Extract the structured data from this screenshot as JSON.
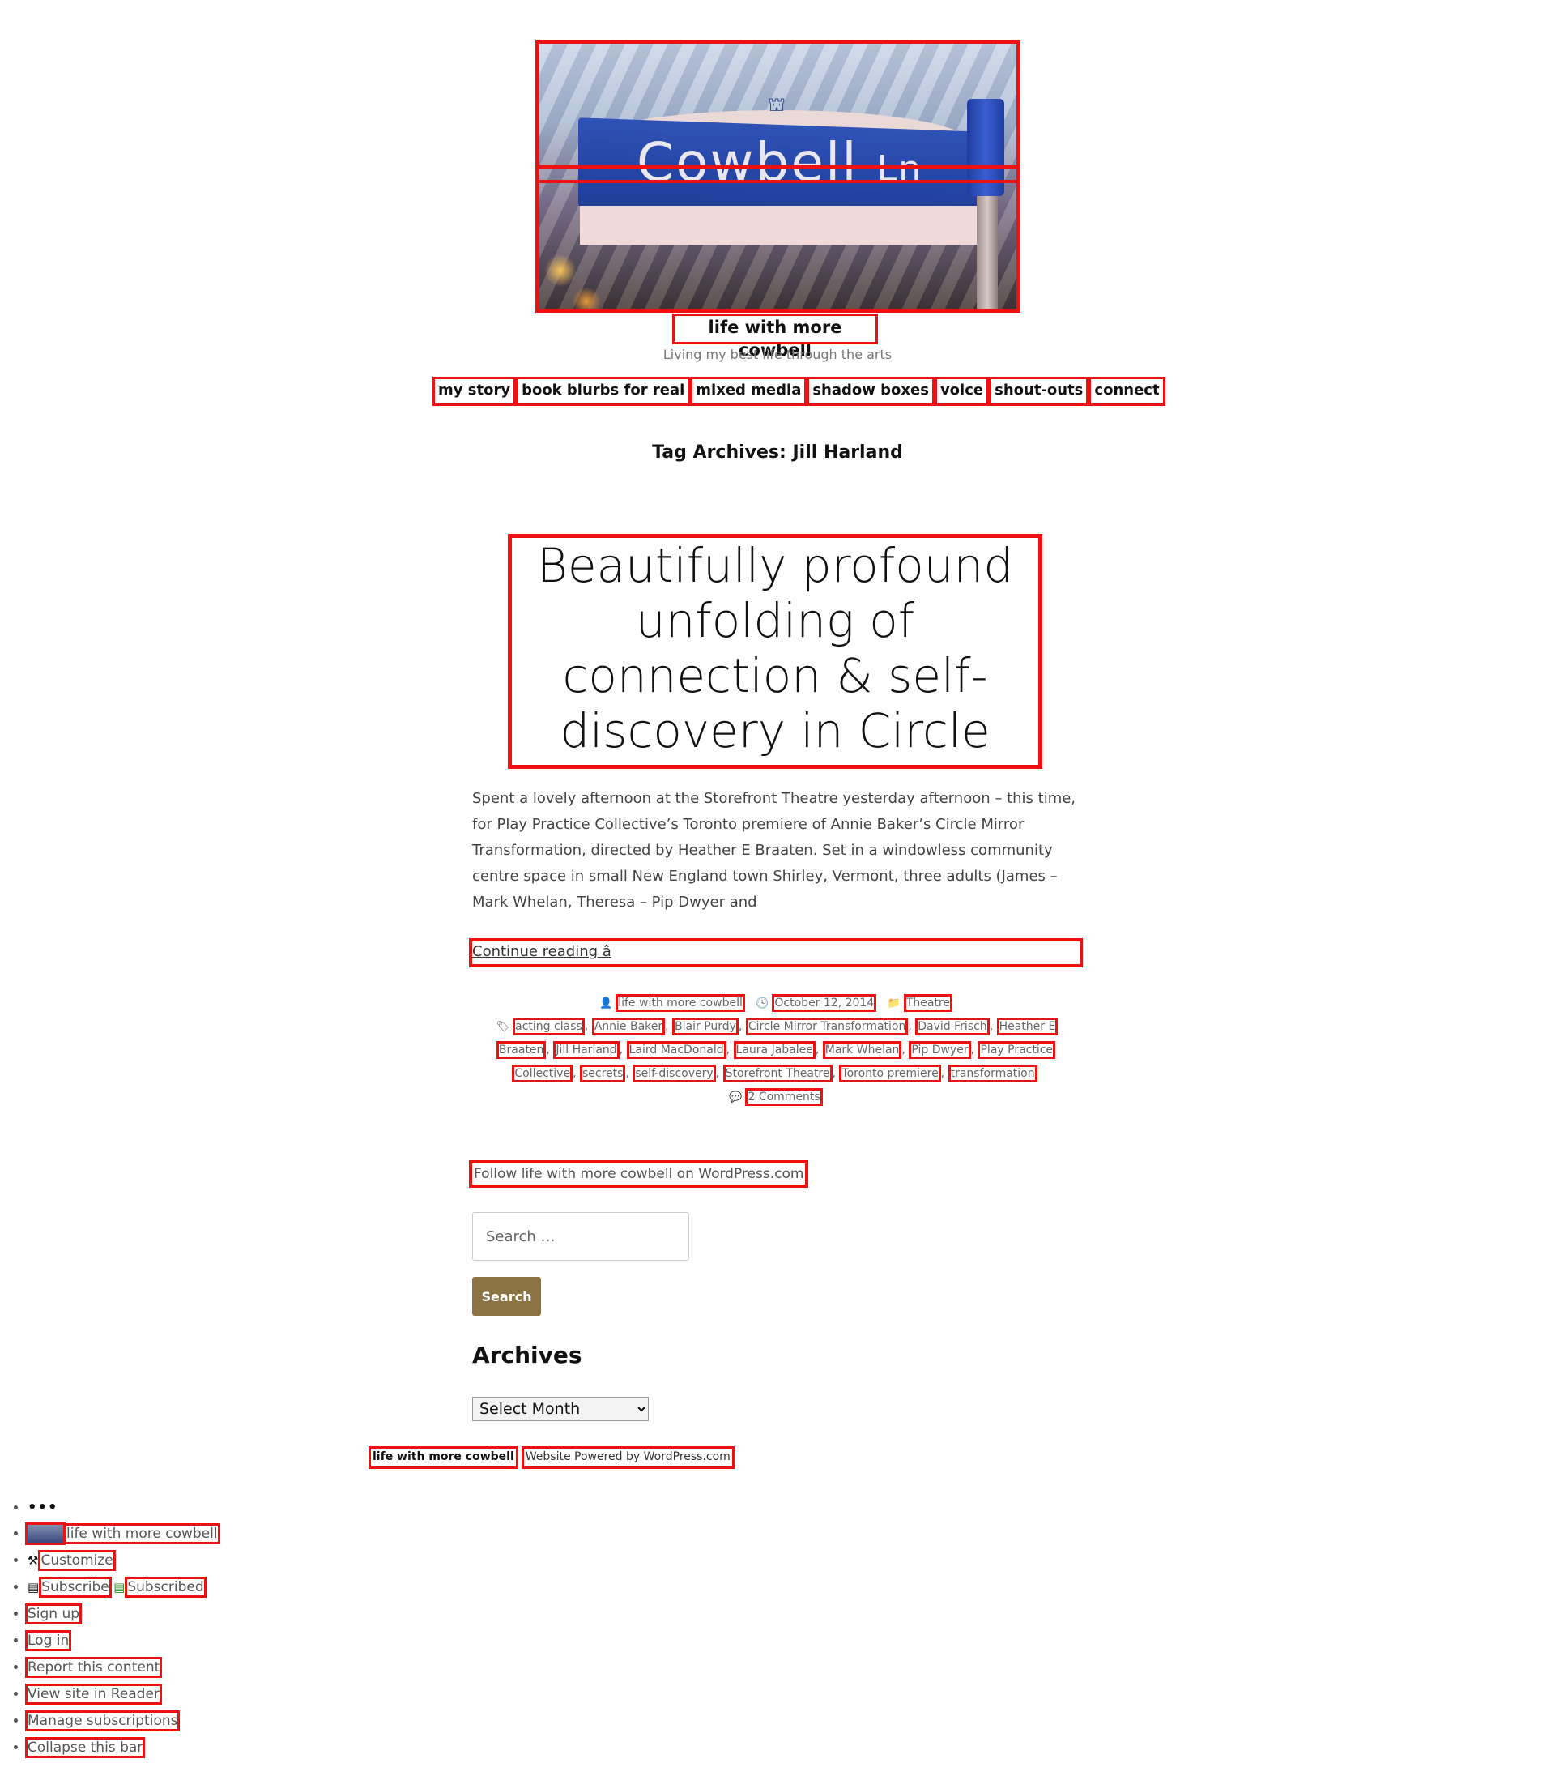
{
  "header": {
    "image_sign_text": "Cowbell",
    "image_sign_suffix": "Ln",
    "site_title": "life with more cowbell",
    "tagline": "Living my best life through the arts"
  },
  "nav": {
    "items": [
      "my story",
      "book blurbs for real",
      "mixed media",
      "shadow boxes",
      "voice",
      "shout-outs",
      "connect"
    ]
  },
  "archive": {
    "title": "Tag Archives: Jill Harland"
  },
  "post": {
    "title": "Beautifully profound unfolding of connection & self-discovery in Circle Mirror Transformation",
    "excerpt": "Spent a lovely afternoon at the Storefront Theatre yesterday afternoon – this time, for Play Practice Collective’s Toronto premiere of Annie Baker’s Circle Mirror Transformation, directed by Heather E Braaten. Set in a windowless community centre space in small New England town Shirley, Vermont, three adults (James – Mark Whelan, Theresa – Pip Dwyer and",
    "continue_label": "Continue reading  â",
    "author": "life with more cowbell",
    "date": "October 12, 2014",
    "category": "Theatre",
    "tags": [
      "acting class",
      "Annie Baker",
      "Blair Purdy",
      "Circle Mirror Transformation",
      "David Frisch",
      "Heather E Braaten",
      "Jill Harland",
      "Laird MacDonald",
      "Laura Jabalee",
      "Mark Whelan",
      "Pip Dwyer",
      "Play Practice Collective",
      "secrets",
      "self-discovery",
      "Storefront Theatre",
      "Toronto premiere",
      "transformation"
    ],
    "comments_label": "2 Comments"
  },
  "sidebar": {
    "follow_label": "Follow life with more cowbell on WordPress.com",
    "search_placeholder": "Search …",
    "search_button": "Search",
    "archives_title": "Archives",
    "archives_select": "Select Month"
  },
  "footer": {
    "site_link": "life with more cowbell",
    "powered_by": "Website Powered by WordPress.com"
  },
  "admin_bar": {
    "dots": "•••",
    "site": "life with more cowbell",
    "customize": "Customize",
    "subscribe": "Subscribe",
    "subscribed": "Subscribed",
    "sign_up": "Sign up",
    "log_in": "Log in",
    "report": "Report this content",
    "reader": "View site in Reader",
    "manage": "Manage subscriptions",
    "collapse": "Collapse this bar"
  }
}
